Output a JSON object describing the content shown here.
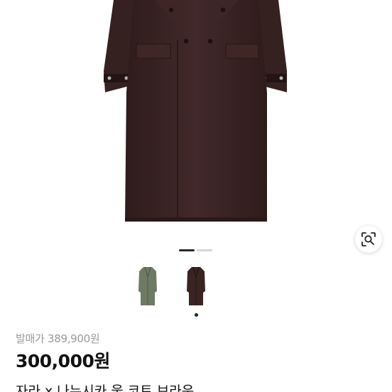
{
  "gallery": {
    "image_alt": "brown wool double-breasted long coat",
    "pager": {
      "current": 1,
      "total": 2
    },
    "thumbnails": [
      {
        "name": "olive-green-coat",
        "color": "#6e7a64",
        "selected": false
      },
      {
        "name": "brown-coat",
        "color": "#3a2422",
        "selected": true
      }
    ],
    "lens_icon": "image-search-icon"
  },
  "product": {
    "original_price_label": "발매가 389,900원",
    "sale_price": "300,000원",
    "title": "자라 x 나누시카 울 코트 브라운"
  },
  "colors": {
    "coat_brown": "#3a2422",
    "coat_green": "#6e7a64",
    "indicator_active": "#2a2a2a",
    "indicator_inactive": "#d6d6d6",
    "price_muted": "#9a9a9a"
  }
}
